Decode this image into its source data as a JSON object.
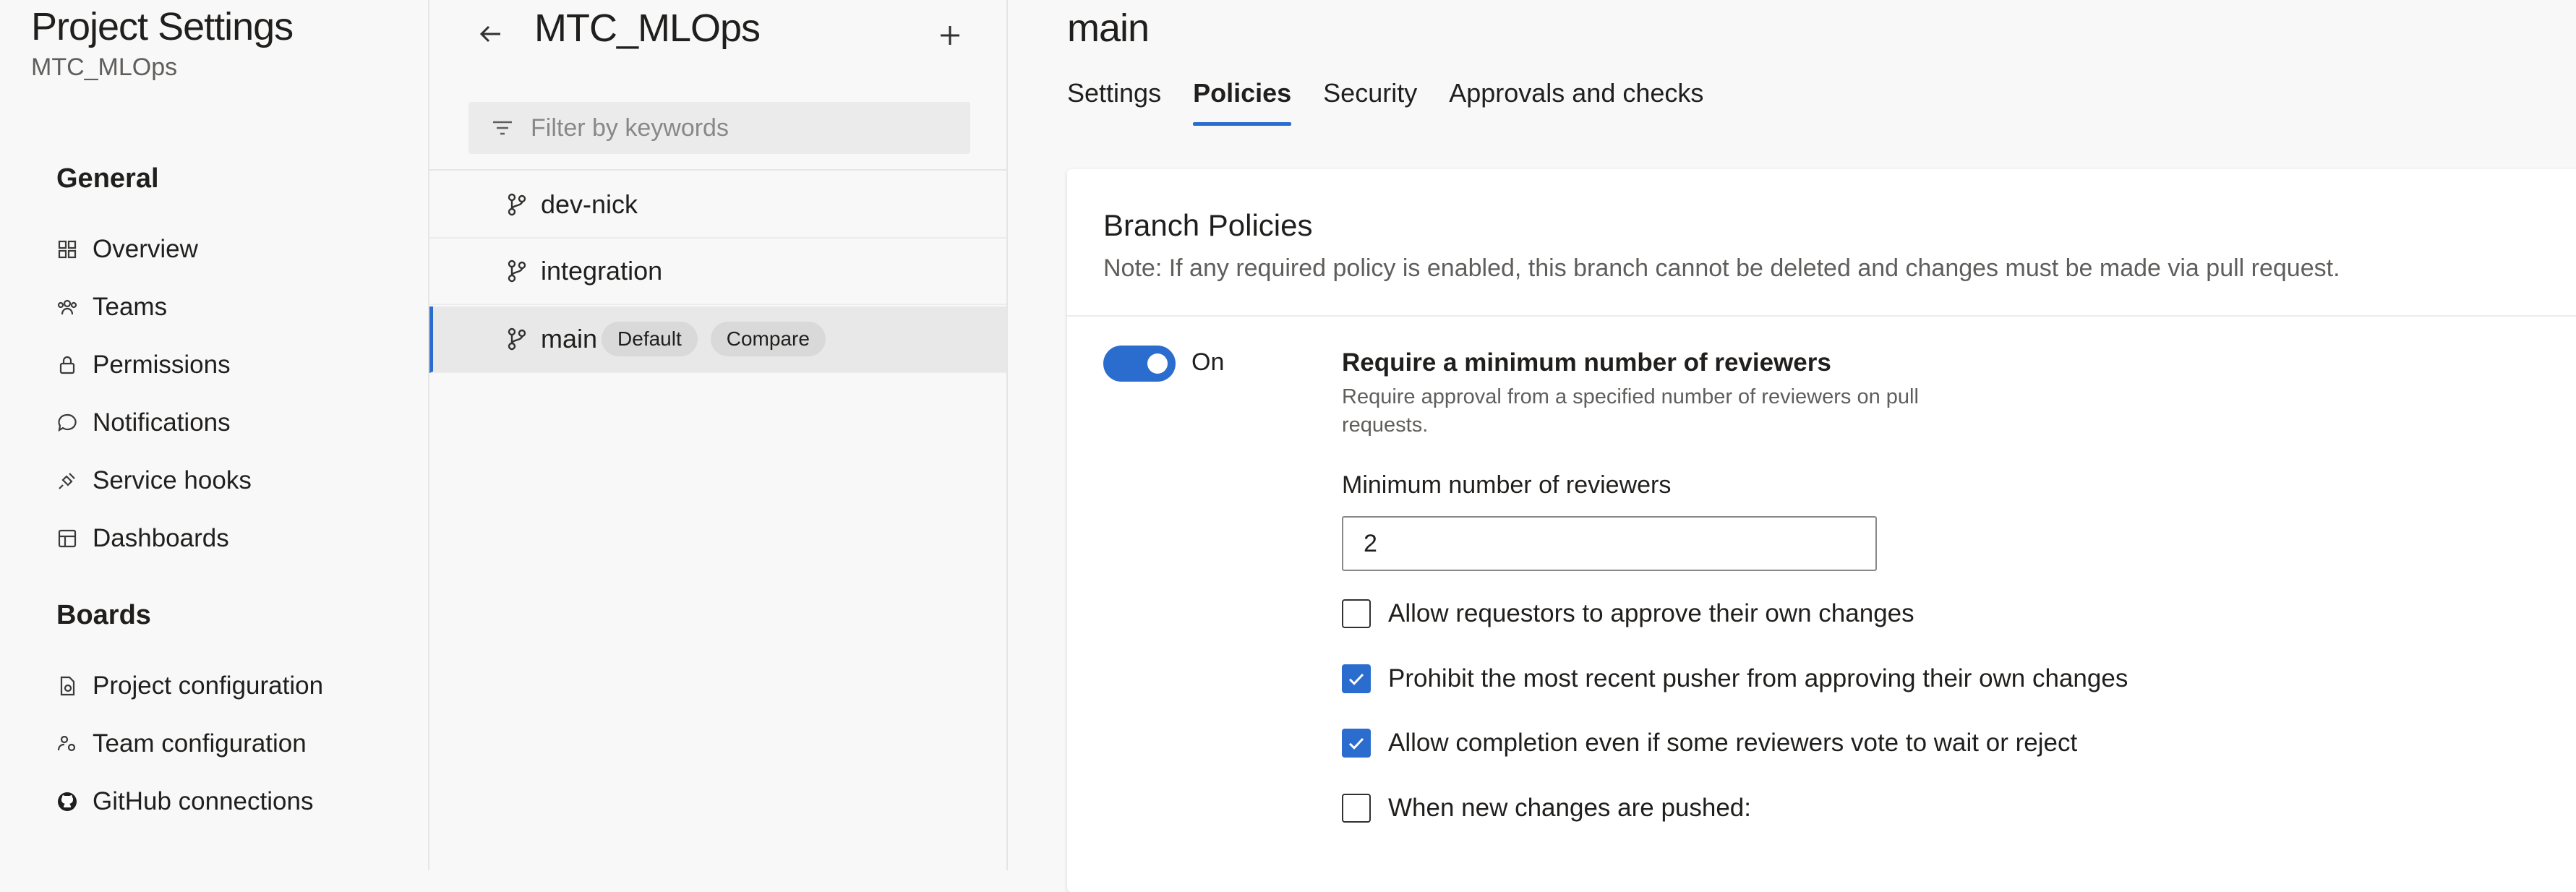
{
  "sidebar": {
    "title": "Project Settings",
    "subtitle": "MTC_MLOps",
    "sections": {
      "general": "General",
      "boards": "Boards"
    },
    "general_items": {
      "overview": "Overview",
      "teams": "Teams",
      "permissions": "Permissions",
      "notifications": "Notifications",
      "service_hooks": "Service hooks",
      "dashboards": "Dashboards"
    },
    "boards_items": {
      "project_configuration": "Project configuration",
      "team_configuration": "Team configuration",
      "github_connections": "GitHub connections"
    }
  },
  "branch_pane": {
    "title": "MTC_MLOps",
    "filter_placeholder": "Filter by keywords",
    "branches": {
      "dev_nick": "dev-nick",
      "integration": "integration",
      "main": "main"
    },
    "default_badge": "Default",
    "compare_label": "Compare"
  },
  "main": {
    "title": "main",
    "tabs": {
      "settings": "Settings",
      "policies": "Policies",
      "security": "Security",
      "approvals": "Approvals and checks"
    },
    "active_tab": "Policies",
    "card": {
      "heading": "Branch Policies",
      "note": "Note: If any required policy is enabled, this branch cannot be deleted and changes must be made via pull request."
    },
    "policy": {
      "toggle_state": "On",
      "title": "Require a minimum number of reviewers",
      "description": "Require approval from a specified number of reviewers on pull requests.",
      "min_reviewers_label": "Minimum number of reviewers",
      "min_reviewers_value": "2",
      "options": {
        "allow_requestors": {
          "label": "Allow requestors to approve their own changes",
          "checked": false
        },
        "prohibit_pusher": {
          "label": "Prohibit the most recent pusher from approving their own changes",
          "checked": true
        },
        "allow_completion": {
          "label": "Allow completion even if some reviewers vote to wait or reject",
          "checked": true
        },
        "new_changes": {
          "label": "When new changes are pushed:",
          "checked": false
        }
      }
    }
  },
  "colors": {
    "accent": "#2b6dcf",
    "background": "#f8f8f8",
    "card": "#ffffff",
    "selected_row": "#e8e8e8"
  },
  "icons": {
    "overview": "overview-icon",
    "teams": "teams-icon",
    "permissions": "lock-icon",
    "notifications": "chat-bubble-icon",
    "service_hooks": "plug-icon",
    "dashboards": "dashboard-icon",
    "project_configuration": "doc-gear-icon",
    "team_configuration": "team-gear-icon",
    "github": "github-icon",
    "back": "arrow-left-icon",
    "add": "plus-icon",
    "filter": "filter-icon",
    "branch": "git-branch-icon",
    "check": "checkmark-icon"
  }
}
